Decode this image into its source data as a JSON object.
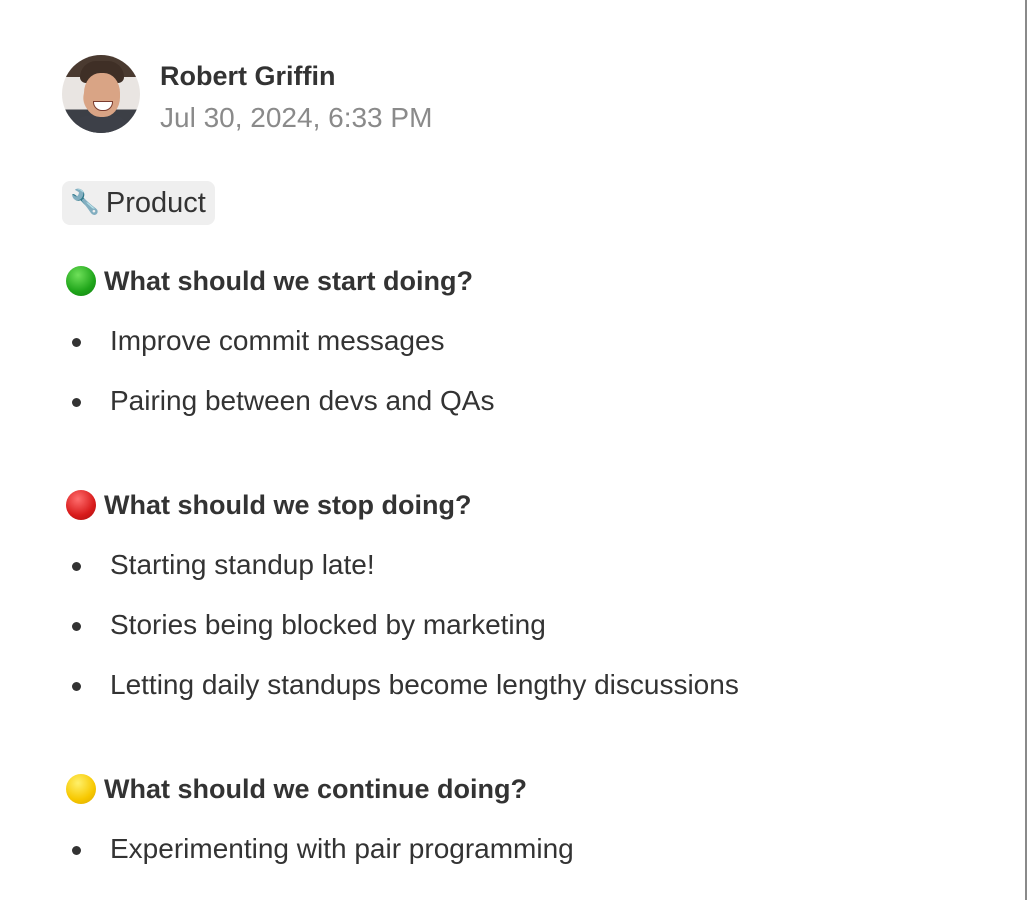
{
  "post": {
    "author": "Robert Griffin",
    "timestamp": "Jul 30, 2024, 6:33 PM",
    "tag": {
      "icon": "wrench-icon",
      "glyph": "🔧",
      "label": "Product"
    }
  },
  "sections": [
    {
      "icon": "green-circle-icon",
      "color": "#1fa51a",
      "title": "What should we start doing?",
      "items": [
        "Improve commit messages",
        "Pairing between devs and QAs"
      ]
    },
    {
      "icon": "red-circle-icon",
      "color": "#d81b1b",
      "title": "What should we stop doing?",
      "items": [
        "Starting standup late!",
        "Stories being blocked by marketing",
        "Letting daily standups become lengthy discussions"
      ]
    },
    {
      "icon": "yellow-circle-icon",
      "color": "#f7c800",
      "title": "What should we continue doing?",
      "items": [
        "Experimenting with pair programming"
      ]
    }
  ]
}
